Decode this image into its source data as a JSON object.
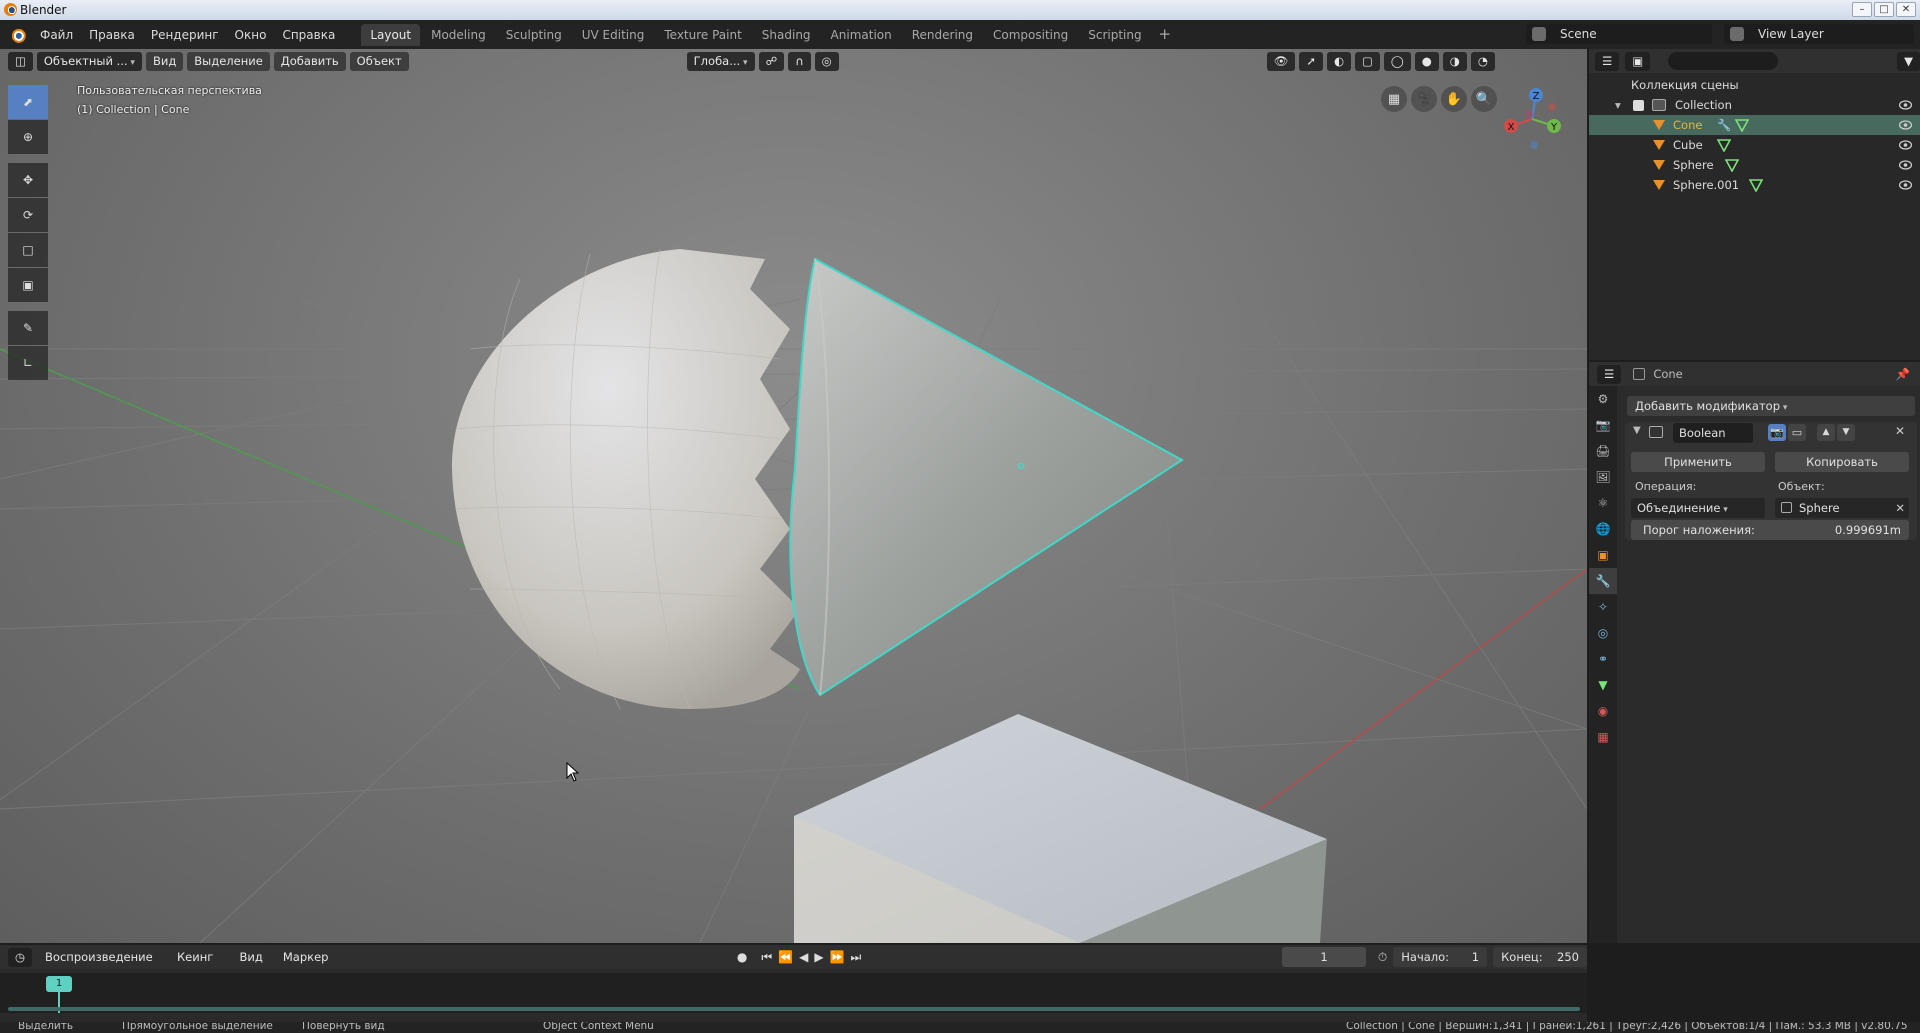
{
  "window": {
    "title": "Blender",
    "controls": [
      "–",
      "□",
      "✕"
    ]
  },
  "menu": [
    "Файл",
    "Правка",
    "Рендеринг",
    "Окно",
    "Справка"
  ],
  "workspaces": [
    "Layout",
    "Modeling",
    "Sculpting",
    "UV Editing",
    "Texture Paint",
    "Shading",
    "Animation",
    "Rendering",
    "Compositing",
    "Scripting"
  ],
  "active_workspace": "Layout",
  "scene": "Scene",
  "view_layer": "View Layer",
  "viewport": {
    "mode": "Объектный ...",
    "menus": [
      "Вид",
      "Выделение",
      "Добавить",
      "Объект"
    ],
    "orientation": "Глоба...",
    "view_name": "Пользовательская перспектива",
    "context_info": "(1) Collection | Cone",
    "gizmo_axes": {
      "x": "X",
      "y": "Y",
      "z": "Z"
    }
  },
  "outliner": {
    "root": "Коллекция сцены",
    "collection": "Collection",
    "objects": [
      "Cone",
      "Cube",
      "Sphere",
      "Sphere.001"
    ],
    "selected": "Cone"
  },
  "properties": {
    "object": "Cone",
    "add_modifier": "Добавить модификатор",
    "modifier": {
      "name": "Boolean",
      "apply": "Применить",
      "copy": "Копировать",
      "operation_label": "Операция:",
      "operation": "Объединение",
      "object_label": "Объект:",
      "object": "Sphere",
      "overlap_label": "Порог наложения:",
      "overlap": "0.999691m"
    }
  },
  "timeline": {
    "menus": [
      "Воспроизведение",
      "Кеинг",
      "Вид",
      "Маркер"
    ],
    "current_frame": "1",
    "start_label": "Начало:",
    "start": "1",
    "end_label": "Конец:",
    "end": "250"
  },
  "statusbar": {
    "select": "Выделить",
    "box_select": "Прямоугольное выделение",
    "rotate": "Повернуть вид",
    "context_menu": "Object Context Menu",
    "stats": "Collection | Cone | Вершин:1,341 | Граней:1,261 | Треуг:2,426 | Объектов:1/4 | Пам.: 53.3 MB | v2.80.75"
  },
  "colors": {
    "selection_outline": "#40d8c8",
    "active_tool": "#5680c2",
    "outliner_selected": "#47695e",
    "x_axis": "#d44a4a",
    "y_axis": "#6fb84a",
    "z_axis": "#4a86d4"
  }
}
